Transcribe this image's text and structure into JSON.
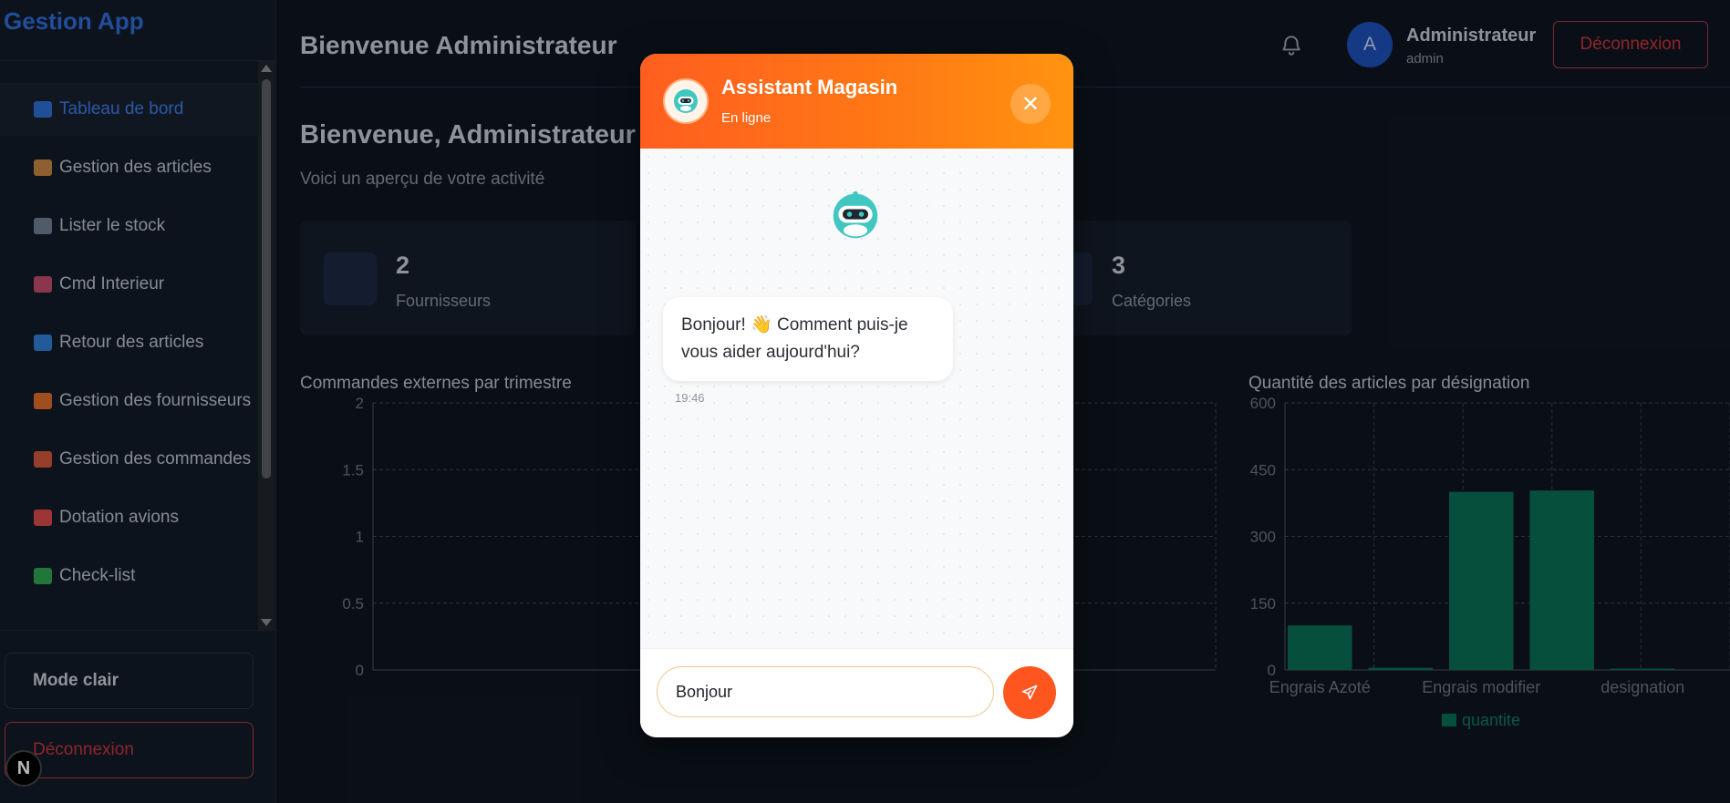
{
  "brand": "Gestion App",
  "sidebar": {
    "items": [
      {
        "icon": "bar-chart-icon",
        "label": "Tableau de bord",
        "color": "#2c6fd1"
      },
      {
        "icon": "package-icon",
        "label": "Gestion des articles",
        "color": "#c68642"
      },
      {
        "icon": "chart-up-icon",
        "label": "Lister le stock",
        "color": "#6f7f94"
      },
      {
        "icon": "inbox-icon",
        "label": "Cmd Interieur",
        "color": "#c04b6b"
      },
      {
        "icon": "return-arrow-icon",
        "label": "Retour des articles",
        "color": "#2e7fd6"
      },
      {
        "icon": "truck-icon",
        "label": "Gestion des fournisseurs",
        "color": "#e06c2c"
      },
      {
        "icon": "clipboard-icon",
        "label": "Gestion des commandes",
        "color": "#d0573d"
      },
      {
        "icon": "airplane-icon",
        "label": "Dotation avions",
        "color": "#d94a4a"
      },
      {
        "icon": "check-icon",
        "label": "Check-list",
        "color": "#2fa44f"
      }
    ],
    "mode_label": "Mode clair",
    "logout_label": "Déconnexion",
    "badge": "N"
  },
  "header": {
    "title": "Bienvenue Administrateur",
    "avatar_letter": "A",
    "user_name": "Administrateur",
    "user_role": "admin",
    "logout_label": "Déconnexion"
  },
  "main": {
    "welcome": "Bienvenue, Administrateur",
    "subtitle": "Voici un aperçu de votre activité",
    "cards": [
      {
        "value": "2",
        "label": "Fournisseurs"
      },
      {
        "value": "3",
        "label": "Catégories"
      }
    ]
  },
  "chart_data": [
    {
      "type": "bar",
      "title": "Commandes externes par trimestre",
      "categories": [],
      "values": [],
      "ylim": [
        0,
        2
      ],
      "yticks": [
        "0",
        "0.5",
        "1",
        "1.5",
        "2"
      ],
      "grid": true
    },
    {
      "type": "bar",
      "title": "Quantité des articles par désignation",
      "categories": [
        "Engrais Azoté",
        "",
        "Engrais modifier",
        "",
        "designation"
      ],
      "series": [
        {
          "name": "quantite",
          "values": [
            100,
            5,
            400,
            403,
            3
          ]
        }
      ],
      "ylim": [
        0,
        600
      ],
      "yticks": [
        "0",
        "150",
        "300",
        "450",
        "600"
      ],
      "bar_color": "#0a6e55",
      "legend": "bottom",
      "grid": true
    }
  ],
  "chat": {
    "title": "Assistant Magasin",
    "status": "En ligne",
    "close": "✕",
    "message": "Bonjour! 👋 Comment puis-je vous aider aujourd'hui?",
    "time": "19:46",
    "input_value": "Bonjour"
  }
}
